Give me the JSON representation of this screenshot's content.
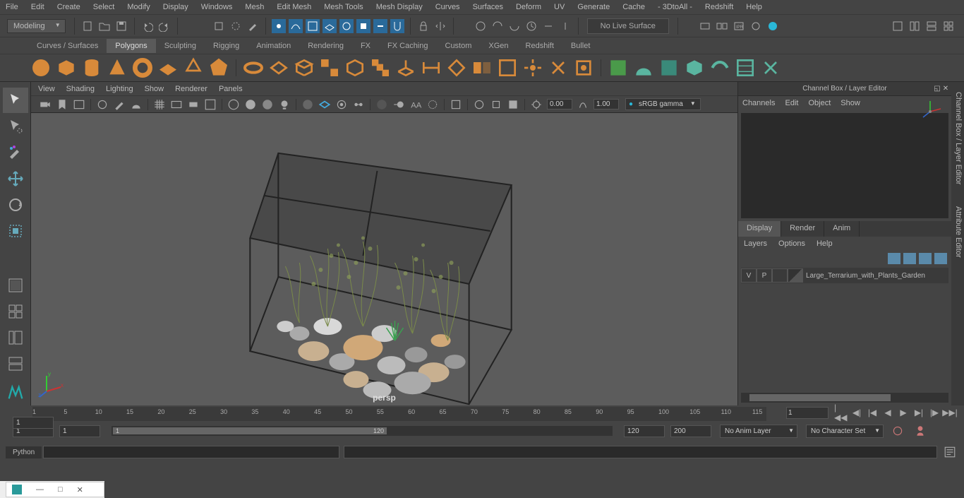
{
  "menu": [
    "File",
    "Edit",
    "Create",
    "Select",
    "Modify",
    "Display",
    "Windows",
    "Mesh",
    "Edit Mesh",
    "Mesh Tools",
    "Mesh Display",
    "Curves",
    "Surfaces",
    "Deform",
    "UV",
    "Generate",
    "Cache",
    "- 3DtoAll -",
    "Redshift",
    "Help"
  ],
  "workspace": "Modeling",
  "liveSurface": "No Live Surface",
  "shelfTabs": [
    "Curves / Surfaces",
    "Polygons",
    "Sculpting",
    "Rigging",
    "Animation",
    "Rendering",
    "FX",
    "FX Caching",
    "Custom",
    "XGen",
    "Redshift",
    "Bullet"
  ],
  "activeShelf": "Polygons",
  "panelMenu": [
    "View",
    "Shading",
    "Lighting",
    "Show",
    "Renderer",
    "Panels"
  ],
  "nearClip": "0.00",
  "farClip": "1.00",
  "colorspace": "sRGB gamma",
  "perspLabel": "persp",
  "channelBox": {
    "title": "Channel Box / Layer Editor",
    "tabs": [
      "Channels",
      "Edit",
      "Object",
      "Show"
    ]
  },
  "layerTabs": [
    "Display",
    "Render",
    "Anim"
  ],
  "activeLayerTab": "Display",
  "layerMenu": [
    "Layers",
    "Options",
    "Help"
  ],
  "layer": {
    "v": "V",
    "p": "P",
    "name": "Large_Terrarium_with_Plants_Garden"
  },
  "sideTabs": [
    "Channel Box / Layer Editor",
    "Attribute Editor"
  ],
  "timeStart": "1",
  "timeStartRange": "1",
  "rangeStart": "1",
  "rangeEnd": "120",
  "timeEnd": "120",
  "timeEndRange": "200",
  "currentFrame": "1",
  "animLayer": "No Anim Layer",
  "charSet": "No Character Set",
  "ticks": [
    1,
    5,
    10,
    15,
    20,
    25,
    30,
    35,
    40,
    45,
    50,
    55,
    60,
    65,
    70,
    75,
    80,
    85,
    90,
    95,
    100,
    105,
    110,
    115
  ],
  "cmdLang": "Python"
}
